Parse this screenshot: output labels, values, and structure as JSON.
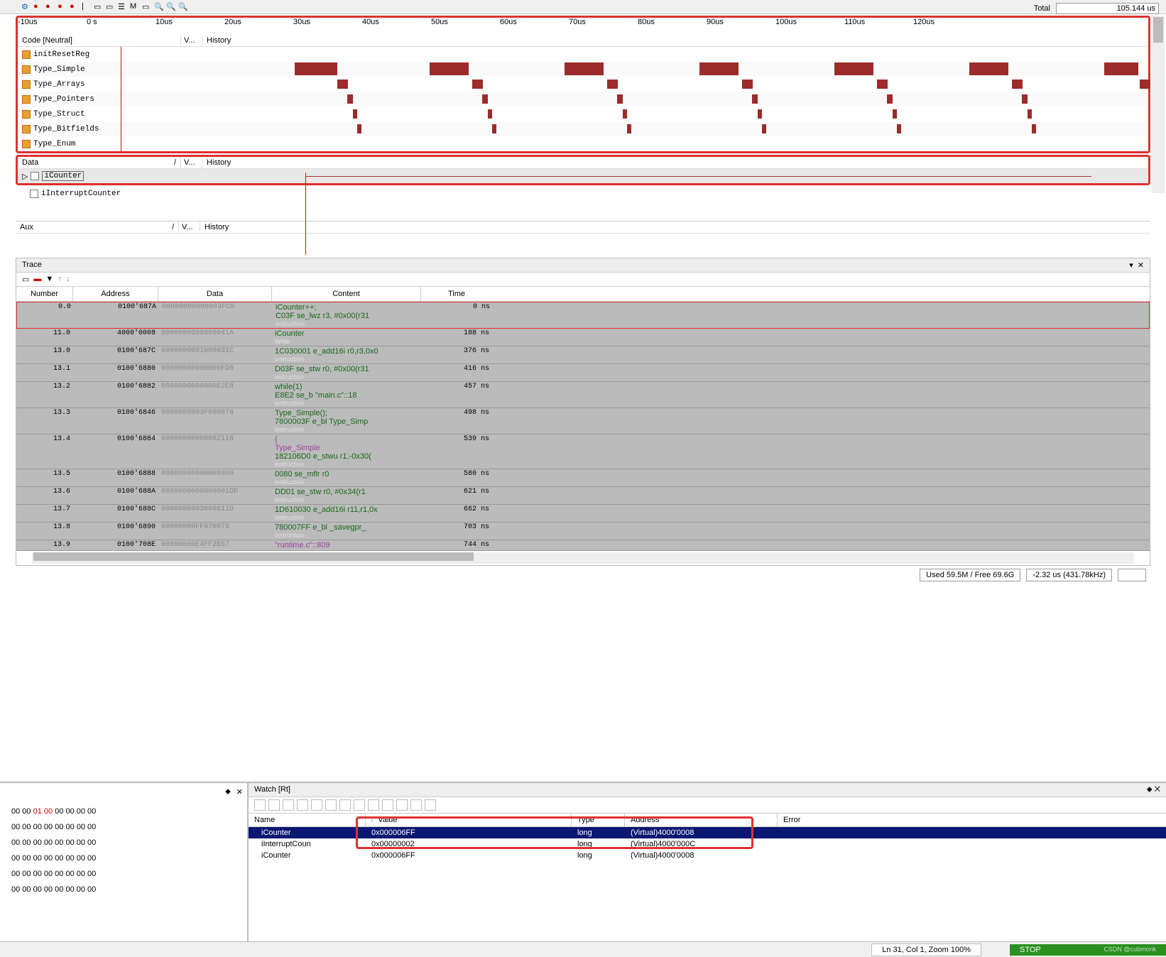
{
  "total": {
    "label": "Total",
    "value": "105.144 us"
  },
  "axis": [
    "-10us",
    "0 s",
    "10us",
    "20us",
    "30us",
    "40us",
    "50us",
    "60us",
    "70us",
    "80us",
    "90us",
    "100us",
    "110us",
    "120us"
  ],
  "code_header": {
    "name": "Code [Neutral]",
    "v": "V...",
    "hist": "History"
  },
  "code_rows": [
    {
      "label": "initResetReg"
    },
    {
      "label": "Type_Simple"
    },
    {
      "label": "Type_Arrays"
    },
    {
      "label": "Type_Pointers"
    },
    {
      "label": "Type_Struct"
    },
    {
      "label": "Type_Bitfields"
    },
    {
      "label": "Type_Enum"
    }
  ],
  "data_header": {
    "name": "Data",
    "v": "V...",
    "hist": "History"
  },
  "data_rows": [
    {
      "label": "iCounter",
      "selected": true
    },
    {
      "label": "iInterruptCounter"
    }
  ],
  "aux_header": {
    "name": "Aux",
    "v": "V...",
    "hist": "History"
  },
  "trace": {
    "title": "Trace",
    "cols": [
      "Number",
      "Address",
      "Data",
      "Content",
      "Time"
    ],
    "rows": [
      {
        "n": "0.0",
        "a": "0100'687A",
        "d": "00000000000003FC0",
        "c": "iCounter++;\nC03F se_lwz    r3, #0x00(r31\ninstruction",
        "t": "0 ns",
        "hl": true
      },
      {
        "n": "11.0",
        "a": "4000'0008",
        "d": "0000000000000041A",
        "c": "iCounter\nWrite",
        "t": "188 ns"
      },
      {
        "n": "13.0",
        "a": "0100'687C",
        "d": "0000000001000031C",
        "c": "1C030001 e_add16i   r0,r3,0x0\ninstruction",
        "t": "376 ns"
      },
      {
        "n": "13.1",
        "a": "0100'6880",
        "d": "00000000000000FD0",
        "c": "D03F se_stw    r0, #0x00(r31\ninstruction",
        "t": "416 ns"
      },
      {
        "n": "13.2",
        "a": "0100'6882",
        "d": "0000000000000E2E8",
        "c": "while(1)\nE8E2 se_b      \"main.c\"::18\ninstruction",
        "t": "457 ns"
      },
      {
        "n": "13.3",
        "a": "0100'6846",
        "d": "0000000003F000078",
        "c": "Type_Simple();\n7800003F e_bl      Type_Simp\ninstruction",
        "t": "498 ns"
      },
      {
        "n": "13.4",
        "a": "0100'6884",
        "d": "00000000000062118",
        "c": "{\nType_Simple\n182106D0 e_stwu    r1,-0x30(\ninstruction",
        "t": "539 ns"
      },
      {
        "n": "13.5",
        "a": "0100'6888",
        "d": "00000000000008000",
        "c": "0080 se_mflr   r0\ninstruction",
        "t": "580 ns"
      },
      {
        "n": "13.6",
        "a": "0100'688A",
        "d": "0000000000000001DD",
        "c": "DD01 se_stw    r0, #0x34(r1\ninstruction",
        "t": "621 ns"
      },
      {
        "n": "13.7",
        "a": "0100'688C",
        "d": "0000000003000611D",
        "c": "1D610030 e_add16i   r11,r1,0x\ninstruction",
        "t": "662 ns"
      },
      {
        "n": "13.8",
        "a": "0100'6890",
        "d": "00000000FF070078",
        "c": "780007FF e_bl      _savegpr_\ninstruction",
        "t": "703 ns"
      },
      {
        "n": "13.9",
        "a": "0100'708E",
        "d": "00000000E4FF2B57",
        "c": "\"runtime.c\"::809",
        "t": "744 ns"
      }
    ]
  },
  "status": {
    "mem": "Used 59.5M / Free 69.6G",
    "cursor": "-2.32 us (431.78kHz)"
  },
  "hex": [
    "00 00 01 00 00 00 00 00",
    "00 00 00 00 00 00 00 00",
    "00 00 00 00 00 00 00 00",
    "00 00 00 00 00 00 00 00",
    "00 00 00 00 00 00 00 00",
    "00 00 00 00 00 00 00 00"
  ],
  "watch": {
    "title": "Watch [Rt]",
    "cols": [
      "Name",
      "Value",
      "Type",
      "Address",
      "Error"
    ],
    "rows": [
      {
        "n": "iCounter",
        "v": "0x000006FF",
        "t": "long",
        "a": "(Virtual)4000'0008",
        "sel": true
      },
      {
        "n": "iInterruptCoun",
        "v": "0x00000002",
        "t": "long",
        "a": "(Virtual)4000'000C"
      },
      {
        "n": "iCounter",
        "v": "0x000006FF",
        "t": "long",
        "a": "(Virtual)4000'0008"
      }
    ]
  },
  "footer": {
    "pos": "Ln 31, Col 1, Zoom 100%",
    "stop": "STOP",
    "csdn": "CSDN @cubmonk"
  }
}
